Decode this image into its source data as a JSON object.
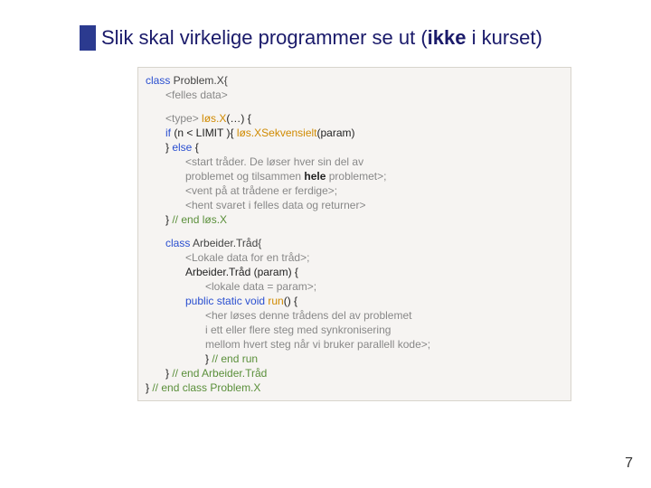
{
  "title": {
    "pre": "Slik skal virkelige programmer se ut (",
    "emph": "ikke",
    "post": " i kurset)"
  },
  "code": {
    "l1_kw": "class",
    "l1_cls": " Problem.X{",
    "l2": "<felles data>",
    "l3_pre": "<type> ",
    "l3_id": "løs.X",
    "l3_post": "(…) {",
    "l4_kw1": "if",
    "l4_mid": " (n < LIMIT ){ ",
    "l4_id": "løs.XSekvensielt",
    "l4_post": "(param)",
    "l5_pre": "} ",
    "l5_kw": "else",
    "l5_post": " {",
    "l6": "<start tråder. De løser hver sin del av",
    "l7a": " problemet og tilsammen ",
    "l7b": "hele",
    "l7c": " problemet>;",
    "l8": "<vent på at trådene er ferdige>;",
    "l9": "<hent svaret i felles data og returner>",
    "l10_pre": "} ",
    "l10_cmt": "// end løs.X",
    "l11_kw": "class",
    "l11_cls": " Arbeider.Tråd{",
    "l12": "<Lokale data for en tråd>;",
    "l13": "Arbeider.Tråd (param) {",
    "l14": "<lokale data = param>;",
    "l15_kw": "public static void",
    "l15_id": " run",
    "l15_post": "() {",
    "l16": "<her løses denne trådens del av problemet",
    "l17": " i ett eller flere steg med synkronisering",
    "l18": " mellom hvert steg når vi bruker parallell kode>;",
    "l19_pre": "} ",
    "l19_cmt": "// end run",
    "l20_pre": "} ",
    "l20_cmt": "// end Arbeider.Tråd",
    "l21_pre": "} ",
    "l21_cmt": "// end class Problem.X"
  },
  "page_number": "7"
}
